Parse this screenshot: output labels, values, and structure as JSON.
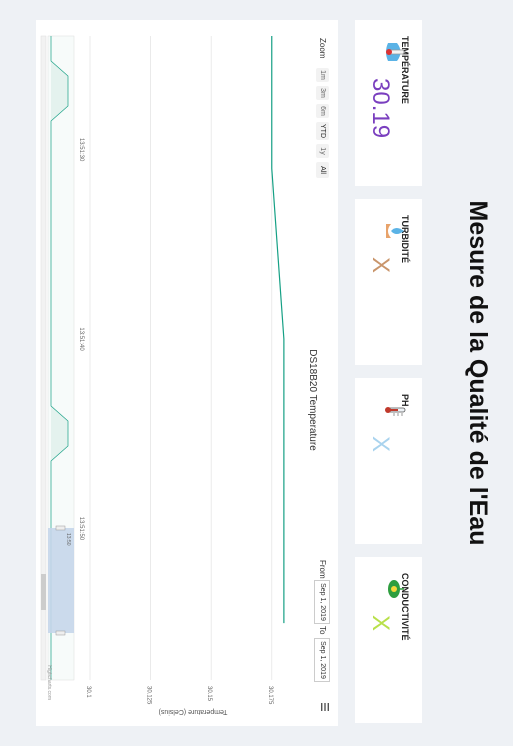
{
  "page": {
    "title": "Mesure de la Qualité de l'Eau"
  },
  "cards": [
    {
      "title": "TEMPÉRATURE",
      "value": "30.19",
      "icon": "thermometer-water-icon",
      "value_color": "#7a3fbf"
    },
    {
      "title": "TURBIDITÉ",
      "value": "X",
      "icon": "water-drop-hand-icon",
      "value_color": "#c9956b"
    },
    {
      "title": "PH",
      "value": "X",
      "icon": "thermometer-icon",
      "value_color": "#a9d3ee"
    },
    {
      "title": "CONDUCTIVITÉ",
      "value": "X",
      "icon": "conductivity-leaf-icon",
      "value_color": "#b8e04a"
    }
  ],
  "rangeSelector": {
    "zoom_label": "Zoom",
    "buttons": [
      "1m",
      "3m",
      "6m",
      "YTD",
      "1y",
      "All"
    ],
    "selected": "All",
    "from_label": "From",
    "from_value": "Sep 1, 2019",
    "to_label": "To",
    "to_value": "Sep 1, 2019"
  },
  "menu_icon": "hamburger-icon",
  "credits": "Highcharts.com",
  "navigator_label": "13:50",
  "chart_data": {
    "type": "line",
    "title": "DS18B20 Temperature",
    "ylabel": "Temperature (Celsius)",
    "yticks": [
      "30.1",
      "30.125",
      "30.15",
      "30.175"
    ],
    "ylim": [
      30.1,
      30.185
    ],
    "xticks": [
      "13:51:30",
      "13:51:40",
      "13:51:50"
    ],
    "series": [
      {
        "name": "Temperature",
        "color": "#16a085",
        "x": [
          "13:51:24",
          "13:51:28",
          "13:51:31",
          "13:51:40",
          "13:51:42",
          "13:51:55"
        ],
        "y": [
          30.175,
          30.175,
          30.175,
          30.18,
          30.18,
          30.18
        ]
      }
    ],
    "xlabels_extra": [
      "13:50"
    ]
  }
}
